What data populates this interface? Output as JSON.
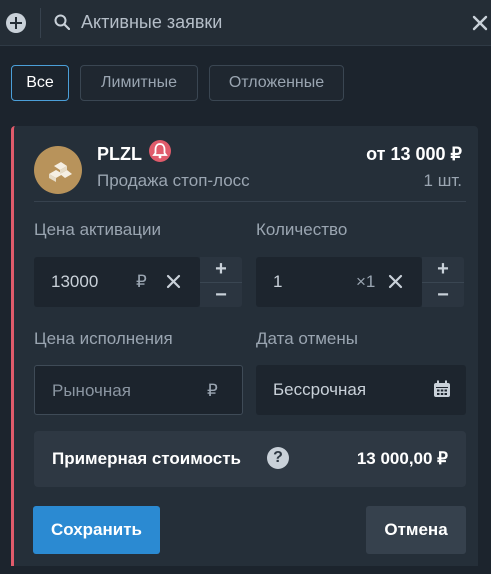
{
  "search": {
    "placeholder": "Активные заявки"
  },
  "tabs": [
    {
      "label": "Все",
      "active": true
    },
    {
      "label": "Лимитные",
      "active": false
    },
    {
      "label": "Отложенные",
      "active": false
    }
  ],
  "order": {
    "ticker": "PLZL",
    "type": "Продажа стоп-лосс",
    "total_from": "от 13 000 ₽",
    "quantity": "1 шт.",
    "accent_color": "#e05b6b"
  },
  "form": {
    "activation_price": {
      "label": "Цена активации",
      "value": "13000",
      "unit": "₽"
    },
    "quantity": {
      "label": "Количество",
      "value": "1",
      "unit": "×1"
    },
    "execution_price": {
      "label": "Цена исполнения",
      "value": "Рыночная",
      "unit": "₽"
    },
    "cancel_date": {
      "label": "Дата отмены",
      "value": "Бессрочная"
    }
  },
  "summary": {
    "label": "Примерная стоимость",
    "value": "13 000,00 ₽"
  },
  "buttons": {
    "save": "Сохранить",
    "cancel": "Отмена"
  },
  "icons": [
    "plus-circle-icon",
    "search-icon",
    "close-icon",
    "bell-icon",
    "help-icon",
    "calendar-icon",
    "clear-icon"
  ]
}
